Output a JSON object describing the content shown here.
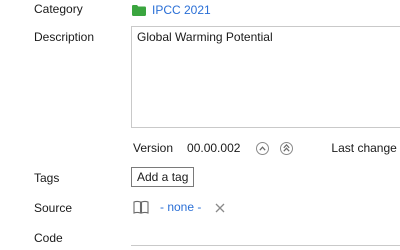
{
  "fields": {
    "category_label": "Category",
    "description_label": "Description",
    "tags_label": "Tags",
    "source_label": "Source",
    "code_label": "Code"
  },
  "category": {
    "value": "IPCC 2021",
    "icon": "folder-icon",
    "icon_color": "#3aa53f"
  },
  "description": {
    "value": "Global Warming Potential"
  },
  "version": {
    "label": "Version",
    "value": "00.00.002",
    "up_icon": "circle-chevron-up-icon",
    "double_up_icon": "circle-double-chevron-up-icon",
    "last_change_label": "Last change"
  },
  "tags": {
    "add_button_label": "Add a tag"
  },
  "source": {
    "icon": "book-icon",
    "value": "- none -",
    "clear_icon": "close-icon"
  },
  "code": {
    "value": ""
  },
  "colors": {
    "link": "#2a6fd6",
    "border": "#c9c9c9"
  }
}
